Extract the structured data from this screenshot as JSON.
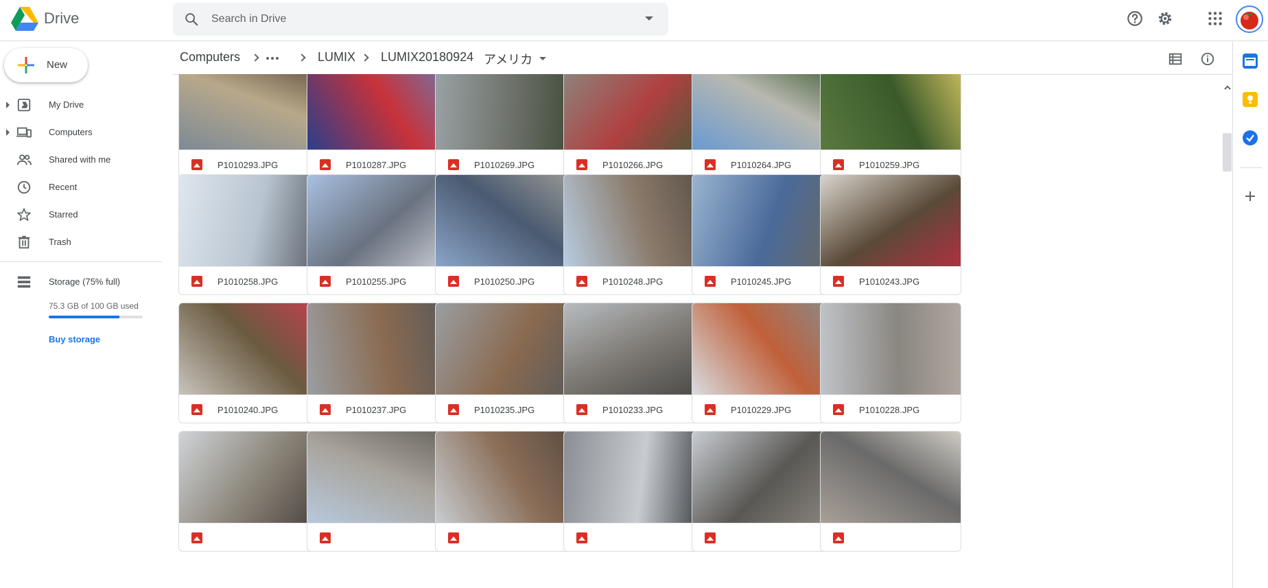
{
  "app": {
    "name": "Drive"
  },
  "search": {
    "placeholder": "Search in Drive"
  },
  "sidebar": {
    "new_label": "New",
    "items": [
      {
        "label": "My Drive",
        "icon": "my-drive-icon",
        "expandable": true
      },
      {
        "label": "Computers",
        "icon": "computers-icon",
        "expandable": true
      },
      {
        "label": "Shared with me",
        "icon": "shared-icon",
        "expandable": false
      },
      {
        "label": "Recent",
        "icon": "clock-icon",
        "expandable": false
      },
      {
        "label": "Starred",
        "icon": "star-icon",
        "expandable": false
      },
      {
        "label": "Trash",
        "icon": "trash-icon",
        "expandable": false
      }
    ],
    "storage": {
      "title": "Storage (75% full)",
      "used": "75.3 GB of 100 GB used",
      "fraction": 0.753,
      "buy_label": "Buy storage"
    }
  },
  "breadcrumb": {
    "items": [
      "Computers",
      "LUMIX",
      "LUMIX20180924",
      "アメリカ"
    ]
  },
  "files": [
    {
      "name": "P1010293.JPG",
      "colors": [
        "#7d8a96",
        "#b8a88a",
        "#5a4a3a"
      ]
    },
    {
      "name": "P1010287.JPG",
      "colors": [
        "#2c3e8c",
        "#c8323a",
        "#6a7ab0"
      ]
    },
    {
      "name": "P1010269.JPG",
      "colors": [
        "#9aa2a6",
        "#6c7068",
        "#3e4a36"
      ]
    },
    {
      "name": "P1010266.JPG",
      "colors": [
        "#8a8a82",
        "#b04040",
        "#4a5a3a"
      ]
    },
    {
      "name": "P1010264.JPG",
      "colors": [
        "#6a9ad0",
        "#b8b8b0",
        "#3a5a30"
      ]
    },
    {
      "name": "P1010259.JPG",
      "colors": [
        "#5a7a40",
        "#3a5a2a",
        "#d0c060"
      ]
    },
    {
      "name": "P1010258.JPG",
      "colors": [
        "#dfe6ee",
        "#b8c4d0",
        "#5a6068"
      ]
    },
    {
      "name": "P1010255.JPG",
      "colors": [
        "#a8c0e0",
        "#6a7280",
        "#c8ccd2"
      ]
    },
    {
      "name": "P1010250.JPG",
      "colors": [
        "#8aa4c8",
        "#4a5a70",
        "#9a9a96"
      ]
    },
    {
      "name": "P1010248.JPG",
      "colors": [
        "#b8cce0",
        "#8a7a6a",
        "#5a5048"
      ]
    },
    {
      "name": "P1010245.JPG",
      "colors": [
        "#9ab4d0",
        "#4a6a9a",
        "#6a6864"
      ]
    },
    {
      "name": "P1010243.JPG",
      "colors": [
        "#d8d4cc",
        "#5a4a38",
        "#b03040"
      ]
    },
    {
      "name": "P1010240.JPG",
      "colors": [
        "#c8c4bc",
        "#6a5a40",
        "#c04050"
      ]
    },
    {
      "name": "P1010237.JPG",
      "colors": [
        "#9a9ea2",
        "#8a6a50",
        "#5a5a5a"
      ]
    },
    {
      "name": "P1010235.JPG",
      "colors": [
        "#9a9ea2",
        "#8a6a50",
        "#5a5a5a"
      ]
    },
    {
      "name": "P1010233.JPG",
      "colors": [
        "#b8bcc0",
        "#7a7670",
        "#4a4a48"
      ]
    },
    {
      "name": "P1010229.JPG",
      "colors": [
        "#d8dce0",
        "#c0603a",
        "#8a8a88"
      ]
    },
    {
      "name": "P1010228.JPG",
      "colors": [
        "#c0c4c8",
        "#8a8680",
        "#b0a8a0"
      ]
    },
    {
      "name": "",
      "colors": [
        "#d0d4d8",
        "#8a8478",
        "#4a4440"
      ]
    },
    {
      "name": "",
      "colors": [
        "#b8c8dc",
        "#a8a49c",
        "#6a6660"
      ]
    },
    {
      "name": "",
      "colors": [
        "#c8ccd0",
        "#8a6e58",
        "#5a4a40"
      ]
    },
    {
      "name": "",
      "colors": [
        "#8a8e94",
        "#c8ccd0",
        "#3a3c40"
      ]
    },
    {
      "name": "",
      "colors": [
        "#c8ccd2",
        "#5a5854",
        "#8a8680"
      ]
    },
    {
      "name": "",
      "colors": [
        "#a8a098",
        "#6a6a6a",
        "#d0ccc4"
      ]
    }
  ],
  "colors": {
    "accent": "#1a73e8",
    "file_icon": "#d93025",
    "divider": "#dadce0"
  }
}
